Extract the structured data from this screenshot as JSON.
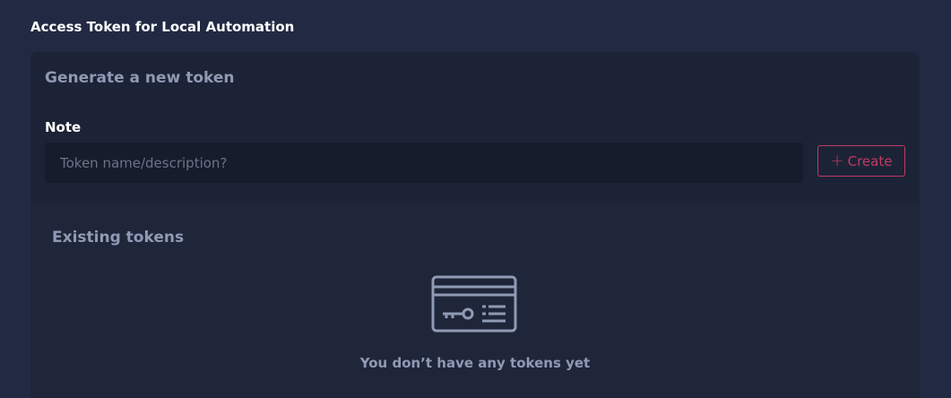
{
  "section": {
    "title": "Access Token for Local Automation"
  },
  "generate": {
    "title": "Generate a new token",
    "note_label": "Note",
    "note_placeholder": "Token name/description?",
    "note_value": "",
    "create_label": "Create",
    "create_icon": "plus-icon"
  },
  "existing": {
    "title": "Existing tokens",
    "empty_icon": "token-card-icon",
    "empty_message": "You don’t have any tokens yet"
  },
  "colors": {
    "background": "#222a43",
    "card": "#1f2639",
    "input": "#171c2c",
    "accent": "#c23a63",
    "muted_text": "#8f9ab4"
  }
}
